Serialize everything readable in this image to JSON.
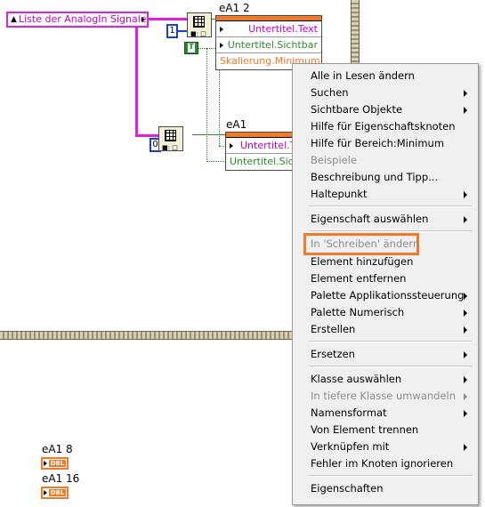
{
  "diagram": {
    "cluster_control_label": "Liste der AnalogIn Signale",
    "index_const_1": "1",
    "index_const_0": "0",
    "bool_const": "T",
    "node1": {
      "title": "eA1 2",
      "rows": [
        "Untertitel.Text",
        "Untertitel.Sichtbar",
        "Skalierung.Minimum"
      ]
    },
    "node2": {
      "title": "eA1",
      "rows": [
        "Untertitel.T",
        "Untertitel.Sic"
      ]
    },
    "ind1": {
      "label": "eA1 8",
      "type": "DBL"
    },
    "ind2": {
      "label": "eA1 16",
      "type": "DBL"
    }
  },
  "context_menu": {
    "items": [
      "Alle in Lesen ändern",
      "Suchen",
      "Sichtbare Objekte",
      "Hilfe für Eigenschaftsknoten",
      "Hilfe für Bereich:Minimum",
      "Beispiele",
      "Beschreibung und Tipp...",
      "Haltepunkt",
      "Eigenschaft auswählen",
      "In 'Schreiben' ändern",
      "Element hinzufügen",
      "Element entfernen",
      "Palette Applikationssteuerung",
      "Palette Numerisch",
      "Erstellen",
      "Ersetzen",
      "Klasse auswählen",
      "In tiefere Klasse umwandeln",
      "Namensformat",
      "Von Element trennen",
      "Verknüpfen mit",
      "Fehler im Knoten ignorieren",
      "Eigenschaften"
    ],
    "highlight_color": "#f07a28"
  }
}
